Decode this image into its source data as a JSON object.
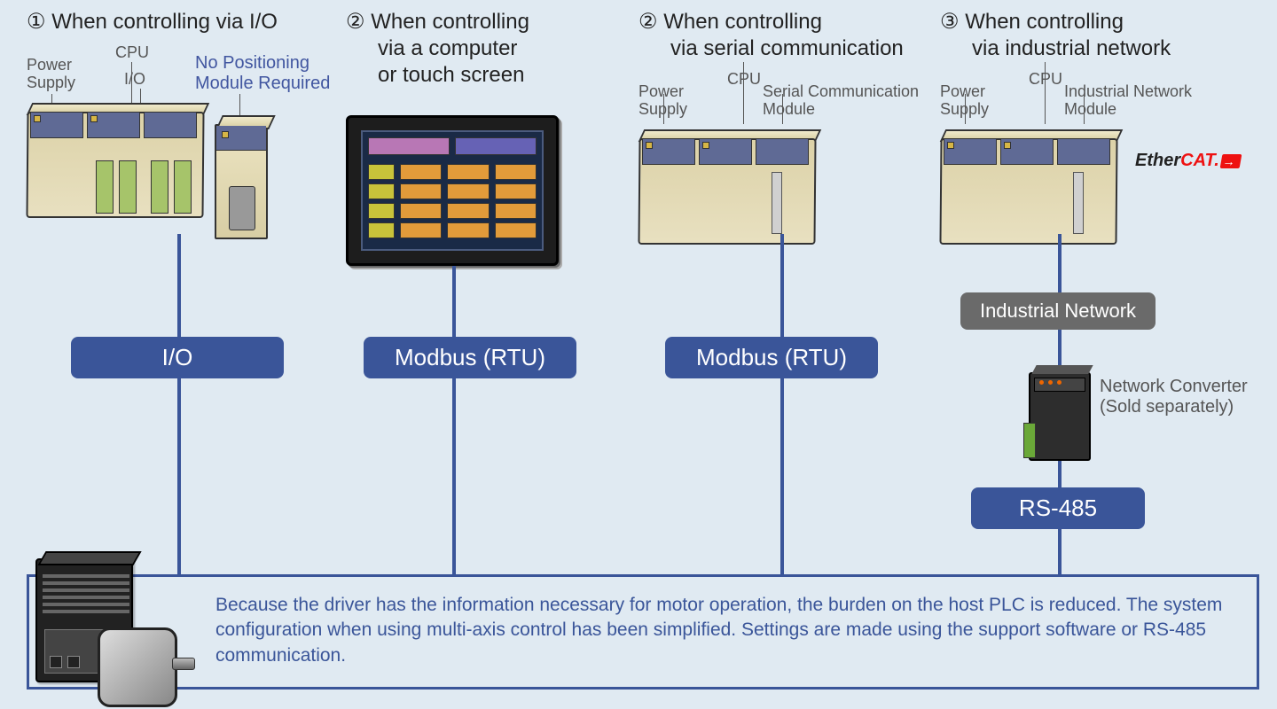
{
  "cols": {
    "c1": {
      "num": "①",
      "title": "When controlling via I/O",
      "labels": {
        "power": "Power\nSupply",
        "cpu": "CPU",
        "io": "I/O",
        "extra": "No Positioning\nModule Required"
      },
      "pill": "I/O"
    },
    "c2": {
      "num": "②",
      "title": "When controlling\nvia a computer\nor touch screen",
      "pill": "Modbus (RTU)"
    },
    "c3": {
      "num": "②",
      "title": "When controlling\nvia serial communication",
      "labels": {
        "power": "Power\nSupply",
        "cpu": "CPU",
        "mod": "Serial Communication\nModule"
      },
      "pill": "Modbus (RTU)"
    },
    "c4": {
      "num": "③",
      "title": "When controlling\nvia industrial network",
      "labels": {
        "power": "Power\nSupply",
        "cpu": "CPU",
        "mod": "Industrial Network\nModule"
      },
      "pill_top": "Industrial Network",
      "pill_bottom": "RS-485",
      "ethercat": "EtherCAT",
      "conv": "Network Converter\n(Sold separately)"
    }
  },
  "footer": "Because the driver has the information necessary for motor operation, the burden on the host PLC is reduced. The system configuration when using multi-axis control has been simplified. Settings are made using the support software or RS-485 communication."
}
